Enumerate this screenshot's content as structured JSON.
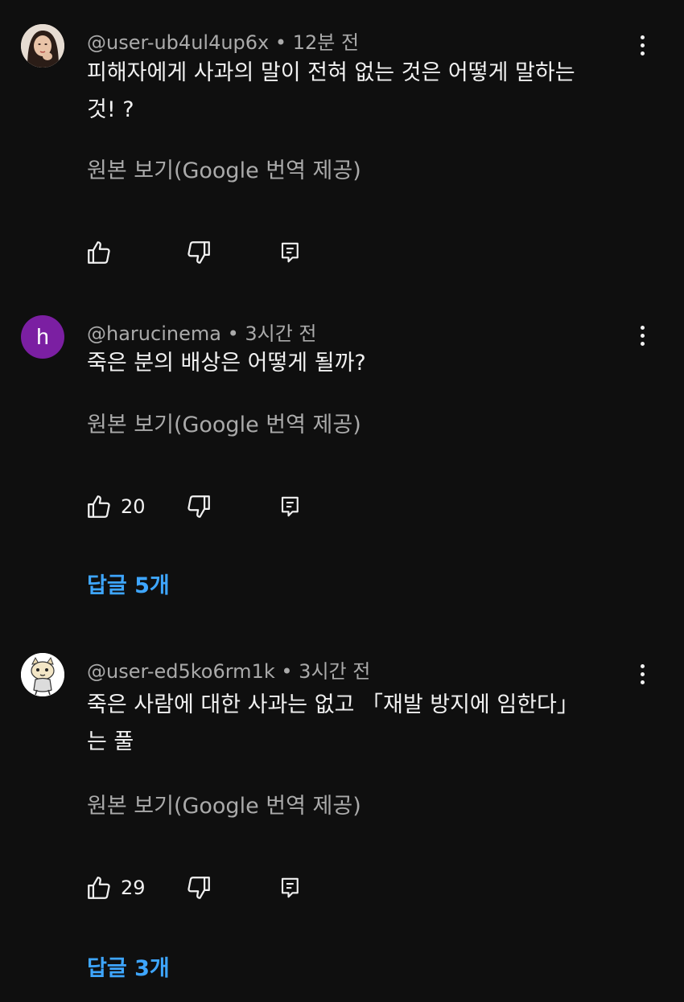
{
  "comments": [
    {
      "author": "@user-ub4ul4up6x",
      "separator": "•",
      "time": "12분 전",
      "text_lines": [
        "피해자에게 사과의 말이 전혀 없는 것은 어떻게 말하는",
        "것! ?"
      ],
      "translation": "원본 보기(Google 번역 제공)",
      "likes": "",
      "avatar_icon": "photo-avatar-woman-icon"
    },
    {
      "author": "@harucinema",
      "separator": "•",
      "time": "3시간 전",
      "text_lines": [
        "죽은 분의 배상은 어떻게 될까?"
      ],
      "translation": "원본 보기(Google 번역 제공)",
      "likes": "20",
      "avatar_letter": "h",
      "avatar_color": "#7b1fa2",
      "replies": "답글 5개"
    },
    {
      "author": "@user-ed5ko6rm1k",
      "separator": "•",
      "time": "3시간 전",
      "text_lines": [
        "죽은 사람에 대한 사과는 없고 「재발 방지에 임한다」",
        "는 풀"
      ],
      "translation": "원본 보기(Google 번역 제공)",
      "likes": "29",
      "avatar_icon": "cartoon-cat-avatar-icon",
      "replies": "답글 3개"
    }
  ],
  "colors": {
    "background": "#0f0f0f",
    "secondary_text": "#aaaaaa",
    "link": "#3ea6ff"
  }
}
